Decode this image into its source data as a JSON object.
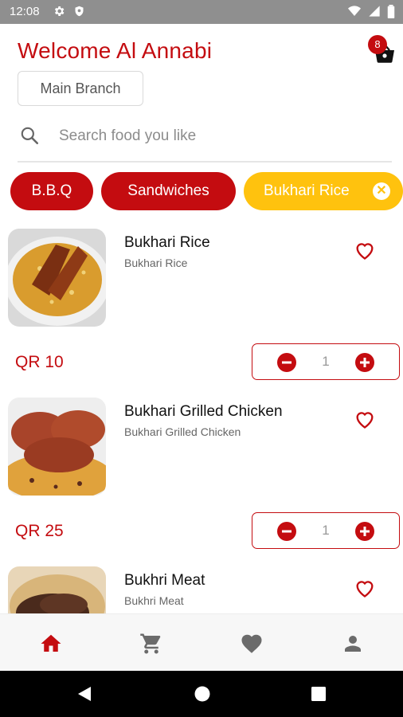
{
  "status_bar": {
    "time": "12:08",
    "icons": [
      "settings-icon",
      "shield-icon",
      "wifi-icon",
      "signal-icon",
      "battery-icon"
    ]
  },
  "header": {
    "welcome": "Welcome Al Annabi",
    "cart_badge": "8",
    "branch_button": "Main Branch"
  },
  "search": {
    "placeholder": "Search food you like",
    "value": ""
  },
  "categories": [
    {
      "label": "B.B.Q",
      "selected": false
    },
    {
      "label": "Sandwiches",
      "selected": false
    },
    {
      "label": "Bukhari Rice",
      "selected": true
    }
  ],
  "items": [
    {
      "title": "Bukhari Rice",
      "subtitle": "Bukhari Rice",
      "price": "QR 10",
      "quantity": "1"
    },
    {
      "title": "Bukhari Grilled Chicken",
      "subtitle": "Bukhari Grilled Chicken",
      "price": "QR 25",
      "quantity": "1"
    },
    {
      "title": "Bukhri Meat",
      "subtitle": "Bukhri Meat",
      "price": "",
      "quantity": ""
    }
  ],
  "bottom_nav": [
    {
      "icon": "home-icon",
      "active": true
    },
    {
      "icon": "cart-icon",
      "active": false
    },
    {
      "icon": "heart-icon",
      "active": false
    },
    {
      "icon": "person-icon",
      "active": false
    }
  ],
  "colors": {
    "brand_red": "#c40c10",
    "accent_yellow": "#ffc20e",
    "status_bar": "#8f8f8f",
    "nav_inactive": "#6b6b6b"
  }
}
